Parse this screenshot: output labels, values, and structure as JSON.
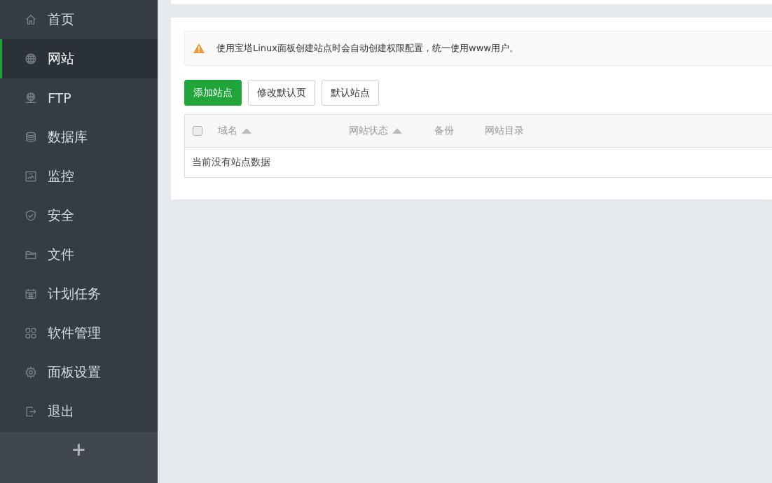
{
  "sidebar": {
    "items": [
      {
        "label": "首页",
        "selected": false
      },
      {
        "label": "网站",
        "selected": true
      },
      {
        "label": "FTP",
        "selected": false
      },
      {
        "label": "数据库",
        "selected": false
      },
      {
        "label": "监控",
        "selected": false
      },
      {
        "label": "安全",
        "selected": false
      },
      {
        "label": "文件",
        "selected": false
      },
      {
        "label": "计划任务",
        "selected": false
      },
      {
        "label": "软件管理",
        "selected": false
      },
      {
        "label": "面板设置",
        "selected": false
      },
      {
        "label": "退出",
        "selected": false
      }
    ],
    "add_button": "+"
  },
  "notice": "使用宝塔Linux面板创建站点时会自动创建权限配置，统一使用www用户。",
  "buttons": [
    {
      "label": "添加站点",
      "kind": "primary"
    },
    {
      "label": "修改默认页",
      "kind": "default"
    },
    {
      "label": "默认站点",
      "kind": "default"
    }
  ],
  "table": {
    "select_all_checked": false,
    "columns": [
      {
        "label": "域名",
        "sortable": true
      },
      {
        "label": "网站状态",
        "sortable": true
      },
      {
        "label": "备份",
        "sortable": false
      },
      {
        "label": "网站目录",
        "sortable": false
      }
    ],
    "empty_text": "当前没有站点数据"
  }
}
